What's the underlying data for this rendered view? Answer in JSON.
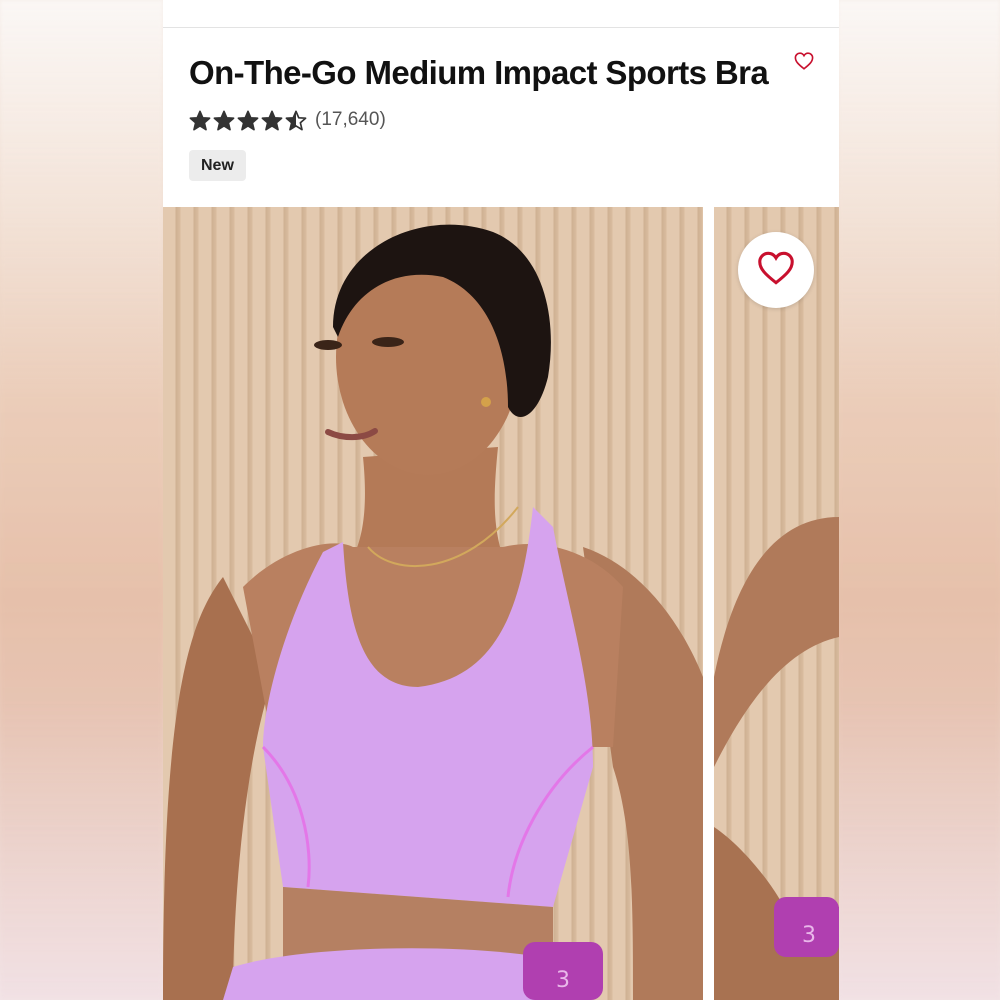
{
  "product": {
    "title": "On-The-Go Medium Impact Sports Bra",
    "rating_value": 4.5,
    "rating_max": 5,
    "review_count": "(17,640)",
    "badge": "New"
  },
  "icons": {
    "wishlist_small": "heart-outline-icon",
    "wishlist_photo": "heart-outline-icon",
    "star": "star-icon"
  },
  "colors": {
    "heart": "#c8102e",
    "star": "#333333",
    "badge_bg": "#ececec",
    "top_color": "#d6a3ee"
  }
}
